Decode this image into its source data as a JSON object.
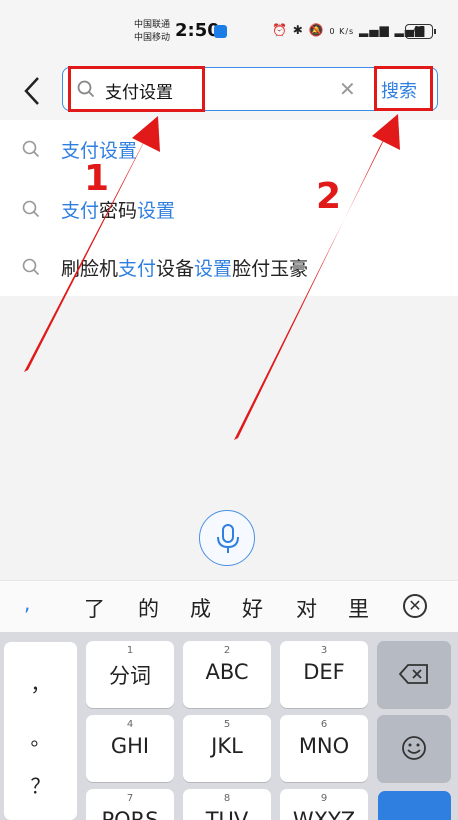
{
  "status": {
    "carrier1": "中国联通",
    "carrier2": "中国移动",
    "time": "2:50",
    "net_speed": "0 K/s",
    "battery": "45"
  },
  "search": {
    "query": "支付设置",
    "submit_label": "搜索"
  },
  "suggestions": [
    {
      "parts": [
        "支付设置"
      ],
      "blue": [
        true
      ]
    },
    {
      "parts": [
        "支付",
        "密码",
        "设置"
      ],
      "blue": [
        true,
        false,
        true
      ]
    },
    {
      "parts": [
        "刷脸机",
        "支付",
        "设备",
        "设置",
        "脸付玉豪"
      ],
      "blue": [
        false,
        true,
        false,
        true,
        false
      ]
    }
  ],
  "candidates": {
    "comma": ",",
    "items": [
      "了",
      "的",
      "成",
      "好",
      "对",
      "里"
    ]
  },
  "keyboard": {
    "symbols": [
      "，",
      "。",
      "？",
      "！"
    ],
    "keys": [
      {
        "num": "1",
        "label": "分词"
      },
      {
        "num": "2",
        "label": "ABC"
      },
      {
        "num": "3",
        "label": "DEF"
      },
      {
        "num": "4",
        "label": "GHI"
      },
      {
        "num": "5",
        "label": "JKL"
      },
      {
        "num": "6",
        "label": "MNO"
      },
      {
        "num": "7",
        "label": "PQRS"
      },
      {
        "num": "8",
        "label": "TUV"
      },
      {
        "num": "9",
        "label": "WXYZ"
      }
    ]
  },
  "annotations": {
    "badge1": "1",
    "badge2": "2",
    "color": "#e11919"
  },
  "colors": {
    "accent": "#2f7fe0",
    "highlight": "#e11919"
  }
}
